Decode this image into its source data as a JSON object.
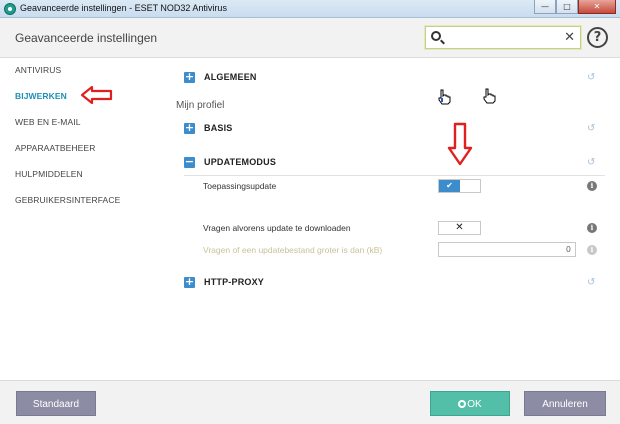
{
  "window": {
    "title": "Geavanceerde instellingen - ESET NOD32 Antivirus",
    "controls": {
      "minimize": "—",
      "maximize": "□",
      "close": "✕"
    }
  },
  "header": {
    "title": "Geavanceerde instellingen",
    "search": {
      "value": "",
      "placeholder": ""
    },
    "clear_symbol": "✕",
    "help_symbol": "?"
  },
  "sidebar": {
    "items": [
      {
        "label": "ANTIVIRUS"
      },
      {
        "label": "BIJWERKEN"
      },
      {
        "label": "WEB EN E-MAIL"
      },
      {
        "label": "APPARAATBEHEER"
      },
      {
        "label": "HULPMIDDELEN"
      },
      {
        "label": "GEBRUIKERSINTERFACE"
      }
    ]
  },
  "main": {
    "profile_label": "Mijn profiel",
    "sections": [
      {
        "label": "ALGEMEEN",
        "expander": "+"
      },
      {
        "label": "BASIS",
        "expander": "+"
      },
      {
        "label": "UPDATEMODUS",
        "expander": "−"
      },
      {
        "label": "HTTP-PROXY",
        "expander": "+"
      }
    ],
    "rows": {
      "app_update": {
        "label": "Toepassingsupdate",
        "toggle_symbol": "✔"
      },
      "ask_before": {
        "label": "Vragen alvorens update te downloaden",
        "symbol": "✕"
      },
      "ask_size": {
        "label": "Vragen of een updatebestand groter is dan (kB)",
        "value": "0"
      }
    },
    "info_symbol": "i",
    "revert_symbol": "↺"
  },
  "footer": {
    "default_label": "Standaard",
    "ok_label": "OK",
    "cancel_label": "Annuleren"
  },
  "colors": {
    "accent": "#3d8dcc",
    "active_sidebar": "#1d8fb5",
    "ok_button": "#53bfa8",
    "secondary_button": "#8c8ca4",
    "annotation_red": "#e02020"
  }
}
